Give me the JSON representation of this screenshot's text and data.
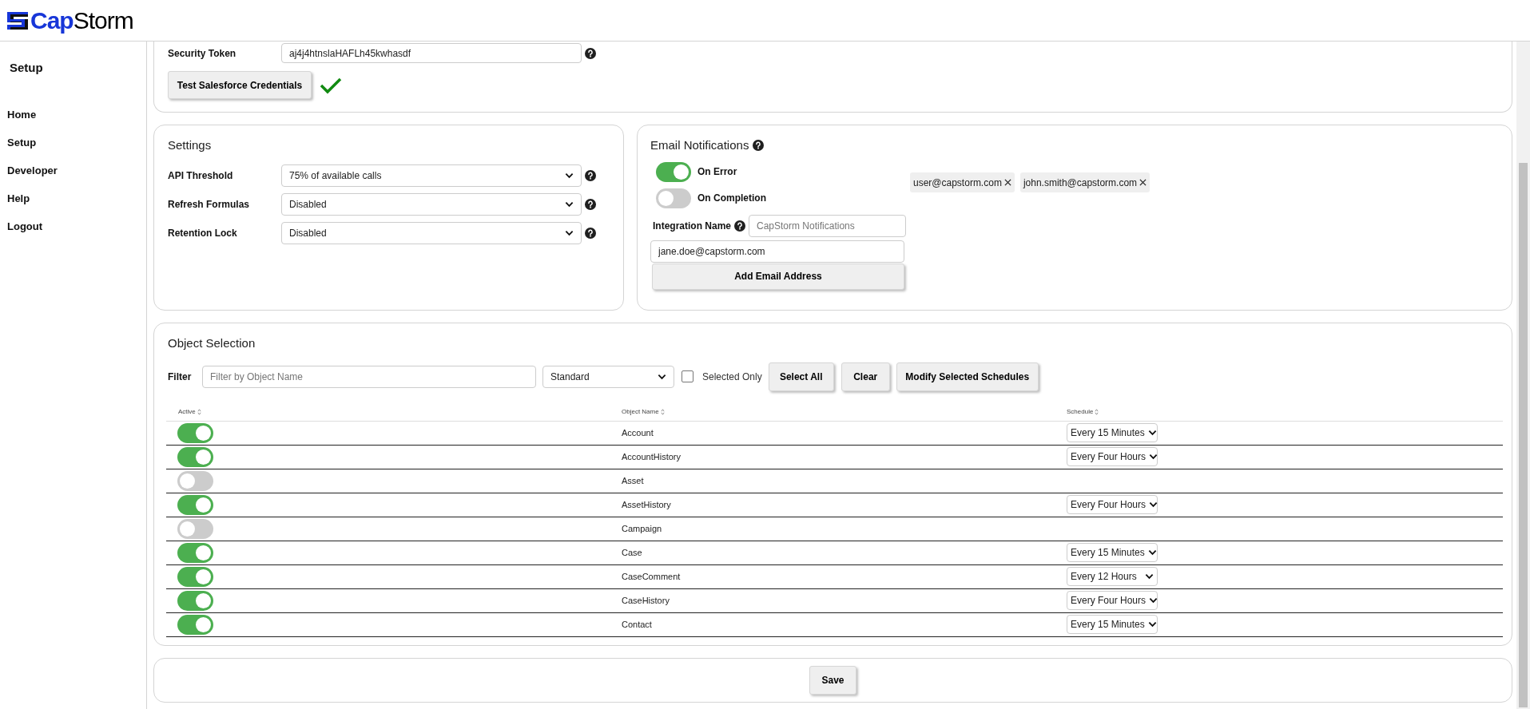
{
  "logo": {
    "primary": "Cap",
    "secondary": "Storm"
  },
  "sidebar": {
    "title": "Setup",
    "items": [
      {
        "label": "Home"
      },
      {
        "label": "Setup"
      },
      {
        "label": "Developer"
      },
      {
        "label": "Help"
      },
      {
        "label": "Logout"
      }
    ]
  },
  "credentials": {
    "security_token": {
      "label": "Security Token",
      "value": "aj4j4htnslaHAFLh45kwhasdf"
    },
    "test_button": "Test Salesforce Credentials",
    "verified": true
  },
  "settings": {
    "title": "Settings",
    "fields": [
      {
        "label": "API Threshold",
        "value": "75% of available calls"
      },
      {
        "label": "Refresh Formulas",
        "value": "Disabled"
      },
      {
        "label": "Retention Lock",
        "value": "Disabled"
      }
    ]
  },
  "email_notifications": {
    "title": "Email Notifications",
    "toggles": [
      {
        "label": "On Error",
        "on": true
      },
      {
        "label": "On Completion",
        "on": false
      }
    ],
    "integration_name": {
      "label": "Integration Name",
      "placeholder": "CapStorm Notifications"
    },
    "email_input": {
      "value": "jane.doe@capstorm.com"
    },
    "add_button": "Add Email Address",
    "recipients": [
      {
        "email": "user@capstorm.com"
      },
      {
        "email": "john.smith@capstorm.com"
      }
    ]
  },
  "object_selection": {
    "title": "Object Selection",
    "filter_label": "Filter",
    "filter": {
      "placeholder": "Filter by Object Name"
    },
    "type_select": "Standard",
    "selected_only": {
      "label": "Selected Only",
      "checked": false
    },
    "buttons": [
      "Select All",
      "Clear",
      "Modify Selected Schedules"
    ],
    "table": {
      "columns": [
        "Active",
        "Object Name",
        "Schedule"
      ],
      "rows": [
        {
          "active": true,
          "object_name": "Account",
          "schedule": "Every 15 Minutes"
        },
        {
          "active": true,
          "object_name": "AccountHistory",
          "schedule": "Every Four Hours"
        },
        {
          "active": false,
          "object_name": "Asset"
        },
        {
          "active": true,
          "object_name": "AssetHistory",
          "schedule": "Every Four Hours"
        },
        {
          "active": false,
          "object_name": "Campaign"
        },
        {
          "active": true,
          "object_name": "Case",
          "schedule": "Every 15 Minutes"
        },
        {
          "active": true,
          "object_name": "CaseComment",
          "schedule": "Every 12 Hours"
        },
        {
          "active": true,
          "object_name": "CaseHistory",
          "schedule": "Every Four Hours"
        },
        {
          "active": true,
          "object_name": "Contact",
          "schedule": "Every 15 Minutes"
        }
      ]
    }
  },
  "save_button": "Save"
}
